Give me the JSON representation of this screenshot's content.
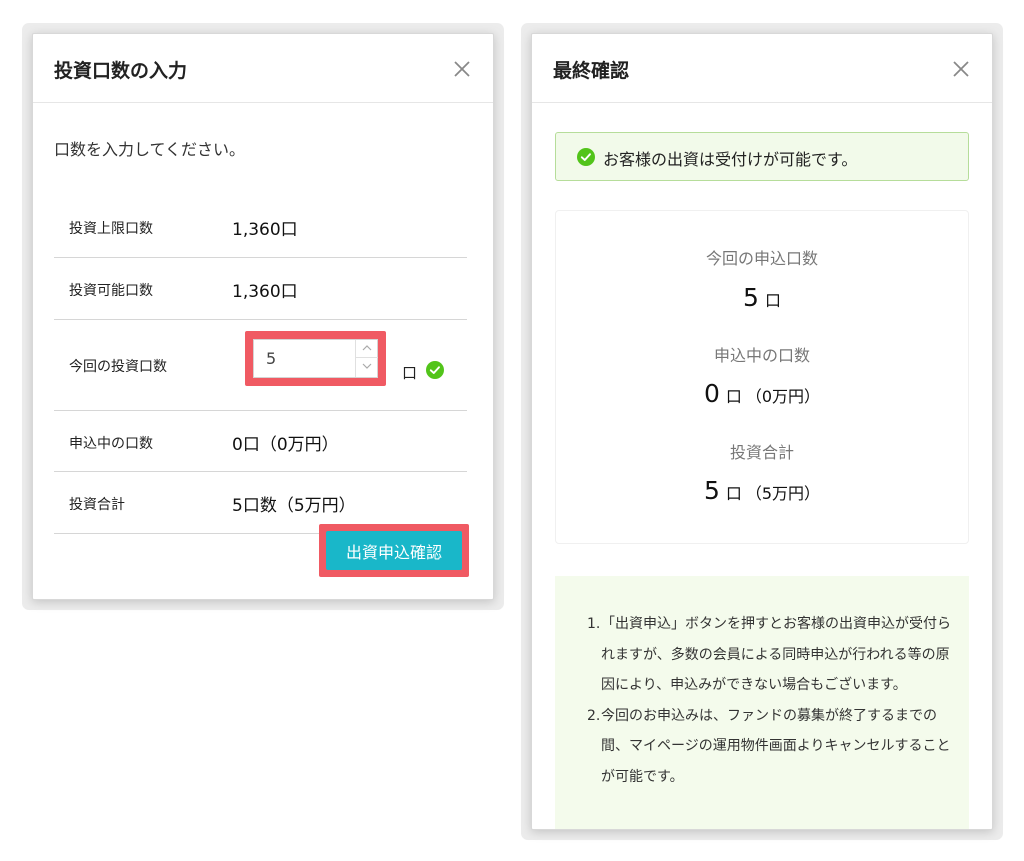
{
  "left_dialog": {
    "title": "投資口数の入力",
    "instruction": "口数を入力してください。",
    "rows": {
      "max_units": {
        "label": "投資上限口数",
        "value": "1,360口"
      },
      "available_units": {
        "label": "投資可能口数",
        "value": "1,360口"
      },
      "current_units": {
        "label": "今回の投資口数",
        "input_value": "5",
        "unit": "口"
      },
      "pending_units": {
        "label": "申込中の口数",
        "value": "0口（0万円）"
      },
      "total": {
        "label": "投資合計",
        "value": "5口数（5万円）"
      }
    },
    "confirm_button": "出資申込確認",
    "icons": {
      "close": "close-icon",
      "valid": "check-circle-icon",
      "step_up": "chevron-up-icon",
      "step_down": "chevron-down-icon"
    }
  },
  "right_dialog": {
    "title": "最終確認",
    "status_message": "お客様の出資は受付けが可能です。",
    "summary": {
      "current_label": "今回の申込口数",
      "current_value": "5",
      "current_unit": "口",
      "pending_label": "申込中の口数",
      "pending_value": "0",
      "pending_unit": "口",
      "pending_yen": "（0万円）",
      "total_label": "投資合計",
      "total_value": "5",
      "total_unit": "口",
      "total_yen": "（5万円）"
    },
    "notes": [
      {
        "num": "1.",
        "text": "「出資申込」ボタンを押すとお客様の出資申込が受付られますが、多数の会員による同時申込が行われる等の原因により、申込みができない場合もございます。"
      },
      {
        "num": "2.",
        "text": "今回のお申込みは、ファンドの募集が終了するまでの間、マイページの運用物件画面よりキャンセルすることが可能です。"
      }
    ]
  },
  "colors": {
    "highlight": "#f05a63",
    "primary_button": "#19b7c9",
    "success": "#52c41a",
    "success_bg": "#f2faea",
    "notes_bg": "#f4fbec"
  }
}
